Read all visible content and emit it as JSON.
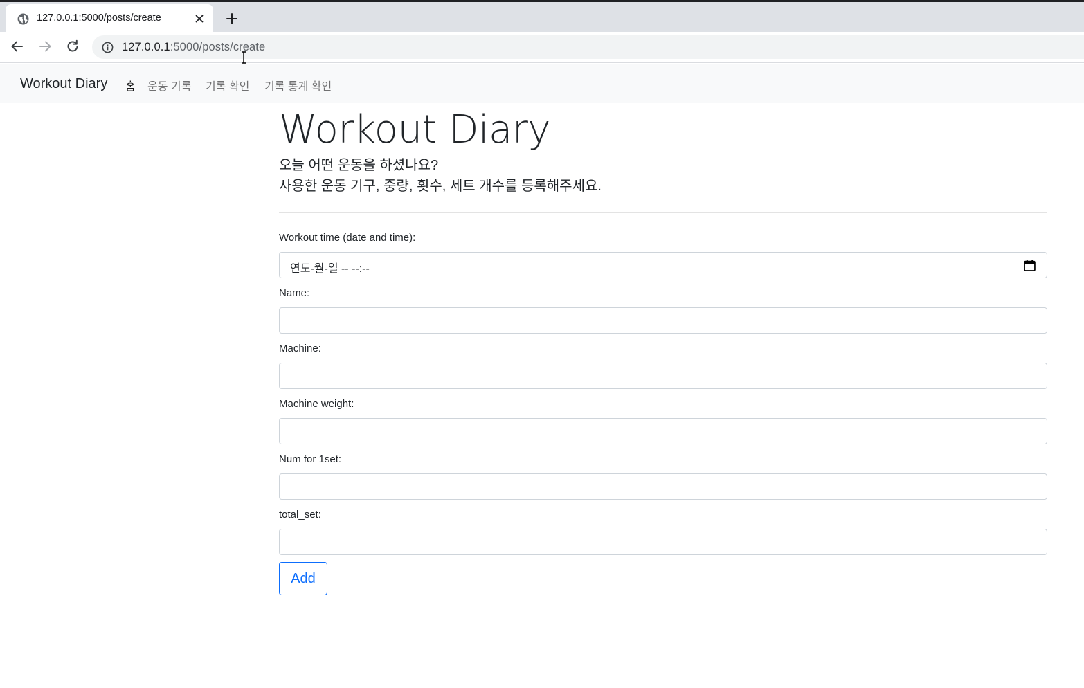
{
  "browser": {
    "tab_title": "127.0.0.1:5000/posts/create",
    "url_host": "127.0.0.1",
    "url_rest": ":5000/posts/create"
  },
  "navbar": {
    "brand": "Workout Diary",
    "links": [
      {
        "label": "홈",
        "active": true
      },
      {
        "label": "운동 기록",
        "active": false
      },
      {
        "label": "기록 확인",
        "active": false
      },
      {
        "label": "기록 통계 확인",
        "active": false
      }
    ]
  },
  "header": {
    "title": "Workout Diary",
    "subtitle_line1": "오늘 어떤 운동을 하셨나요?",
    "subtitle_line2": "사용한 운동 기구, 중량, 횟수, 세트 개수를 등록해주세요."
  },
  "form": {
    "workout_time_label": "Workout time (date and time):",
    "workout_time_display": "연도-월-일 -- --:--",
    "name_label": "Name:",
    "name_value": "",
    "machine_label": "Machine:",
    "machine_value": "",
    "machine_weight_label": "Machine weight:",
    "machine_weight_value": "",
    "num_label": "Num for 1set:",
    "num_value": "",
    "total_set_label": "total_set:",
    "total_set_value": "",
    "submit_label": "Add"
  },
  "colors": {
    "primary": "#0d6efd",
    "navbar_bg": "#f8f9fa",
    "chrome_bg": "#dee1e6"
  }
}
